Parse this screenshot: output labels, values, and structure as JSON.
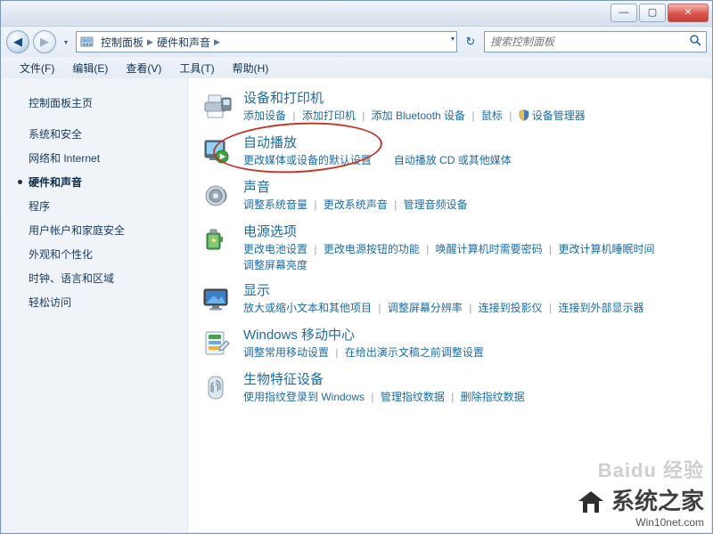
{
  "window": {
    "buttons": {
      "minimize": "—",
      "maximize": "▢",
      "close": "✕"
    }
  },
  "address": {
    "back": "◀",
    "forward": "▶",
    "recent": "▾",
    "crumbs": [
      "控制面板",
      "硬件和声音"
    ],
    "crumb_sep": "▶",
    "crumb_dropdown": "▾",
    "refresh": "↻",
    "search_placeholder": "搜索控制面板",
    "search_value": "",
    "search_icon": "search-icon"
  },
  "menu": {
    "items": [
      "文件(F)",
      "编辑(E)",
      "查看(V)",
      "工具(T)",
      "帮助(H)"
    ]
  },
  "sidebar": {
    "home": "控制面板主页",
    "items": [
      {
        "label": "系统和安全",
        "current": false
      },
      {
        "label": "网络和 Internet",
        "current": false
      },
      {
        "label": "硬件和声音",
        "current": true
      },
      {
        "label": "程序",
        "current": false
      },
      {
        "label": "用户帐户和家庭安全",
        "current": false
      },
      {
        "label": "外观和个性化",
        "current": false
      },
      {
        "label": "时钟、语言和区域",
        "current": false
      },
      {
        "label": "轻松访问",
        "current": false
      }
    ]
  },
  "main": {
    "groups": [
      {
        "icon": "printer-icon",
        "title": "设备和打印机",
        "links": [
          {
            "text": "添加设备",
            "type": "link"
          },
          {
            "text": "添加打印机",
            "type": "link"
          },
          {
            "text": "添加 Bluetooth 设备",
            "type": "link"
          },
          {
            "text": "鼠标",
            "type": "link"
          },
          {
            "text": "设备管理器",
            "type": "link",
            "icon": "shield-icon"
          }
        ]
      },
      {
        "icon": "autoplay-icon",
        "title": "自动播放",
        "links": [
          {
            "text": "更改媒体或设备的默认设置",
            "type": "link"
          },
          {
            "text": "自动播放 CD 或其他媒体",
            "type": "link"
          }
        ]
      },
      {
        "icon": "sound-icon",
        "title": "声音",
        "links": [
          {
            "text": "调整系统音量",
            "type": "link"
          },
          {
            "text": "更改系统声音",
            "type": "link"
          },
          {
            "text": "管理音频设备",
            "type": "link"
          }
        ]
      },
      {
        "icon": "power-icon",
        "title": "电源选项",
        "links": [
          {
            "text": "更改电池设置",
            "type": "link"
          },
          {
            "text": "更改电源按钮的功能",
            "type": "link"
          },
          {
            "text": "唤醒计算机时需要密码",
            "type": "link"
          },
          {
            "text": "更改计算机睡眠时间",
            "type": "link"
          },
          {
            "text": "调整屏幕亮度",
            "type": "link",
            "newline": true
          }
        ]
      },
      {
        "icon": "display-icon",
        "title": "显示",
        "links": [
          {
            "text": "放大或缩小文本和其他项目",
            "type": "link"
          },
          {
            "text": "调整屏幕分辨率",
            "type": "link"
          },
          {
            "text": "连接到投影仪",
            "type": "link"
          },
          {
            "text": "连接到外部显示器",
            "type": "link"
          }
        ]
      },
      {
        "icon": "mobility-icon",
        "title": "Windows 移动中心",
        "links": [
          {
            "text": "调整常用移动设置",
            "type": "link"
          },
          {
            "text": "在给出演示文稿之前调整设置",
            "type": "link"
          }
        ]
      },
      {
        "icon": "biometric-icon",
        "title": "生物特征设备",
        "links": [
          {
            "text": "使用指纹登录到 Windows",
            "type": "link"
          },
          {
            "text": "管理指纹数据",
            "type": "link"
          },
          {
            "text": "删除指纹数据",
            "type": "link"
          }
        ]
      }
    ],
    "annotation": {
      "shape": "ellipse",
      "color": "#c0392b",
      "target": "自动播放"
    }
  },
  "watermark": {
    "top": "Baidu 经验",
    "main": "系统之家",
    "sub": "Win10net.com"
  },
  "colors": {
    "link": "#1d6ba8",
    "title_link": "#1d6ba8",
    "annotation": "#c0392b",
    "close_button": "#c23f37"
  }
}
